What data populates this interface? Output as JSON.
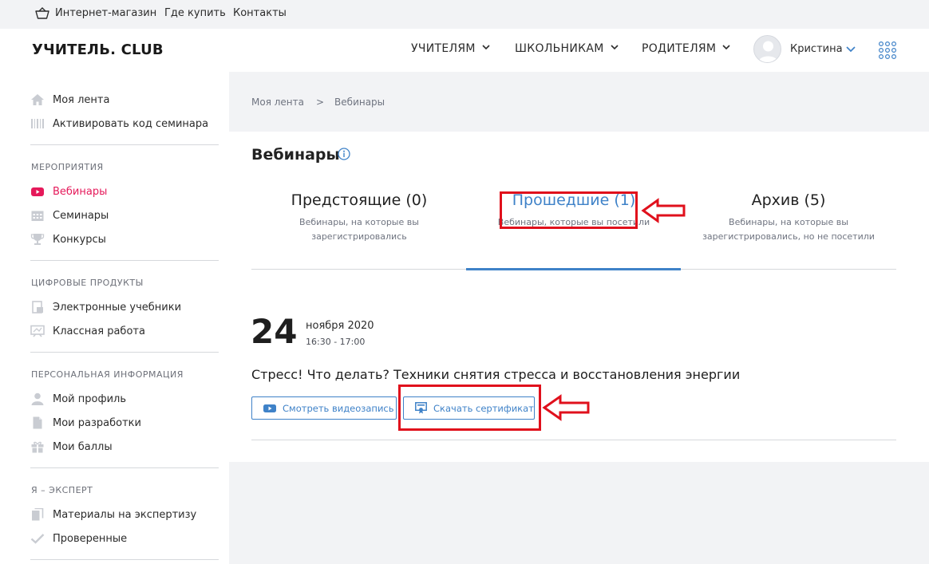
{
  "topbar": {
    "shop": "Интернет-магазин",
    "where_to_buy": "Где купить",
    "contacts": "Контакты"
  },
  "header": {
    "logo": "УЧИТЕЛЬ. CLUB",
    "menu": [
      "УЧИТЕЛЯМ",
      "ШКОЛЬНИКАМ",
      "РОДИТЕЛЯМ"
    ],
    "user_name": "Кристина",
    "icons": [
      "basket-icon",
      "chevron-down-icon",
      "avatar",
      "apps-grid-icon"
    ]
  },
  "sidebar": {
    "items_top": [
      "Моя лента",
      "Активировать код семинара"
    ],
    "sections": [
      {
        "title": "МЕРОПРИЯТИЯ",
        "items": [
          "Вебинары",
          "Семинары",
          "Конкурсы"
        ]
      },
      {
        "title": "ЦИФРОВЫЕ ПРОДУКТЫ",
        "items": [
          "Электронные учебники",
          "Классная работа"
        ]
      },
      {
        "title": "ПЕРСОНАЛЬНАЯ ИНФОРМАЦИЯ",
        "items": [
          "Мой профиль",
          "Мои разработки",
          "Мои баллы"
        ]
      },
      {
        "title": "Я – ЭКСПЕРТ",
        "items": [
          "Материалы на экспертизу",
          "Проверенные"
        ]
      }
    ],
    "active_item": "Вебинары",
    "active_color": "#e5195a"
  },
  "breadcrumb": {
    "home": "Моя лента",
    "separator": ">",
    "current": "Вебинары"
  },
  "page": {
    "title": "Вебинары"
  },
  "tabs": [
    {
      "label": "Предстоящие (0)",
      "desc": "Вебинары, на которые вы зарегистрировались"
    },
    {
      "label": "Прошедшие (1)",
      "desc": "Вебинары, которые вы посетили",
      "active": true
    },
    {
      "label": "Архив (5)",
      "desc": "Вебинары, на которые вы зарегистрировались, но не посетили"
    }
  ],
  "event": {
    "day": "24",
    "month_year": "ноября 2020",
    "time": "16:30 - 17:00",
    "title": "Стресс! Что делать? Техники снятия стресса и восстановления энергии",
    "watch_button": "Смотреть видеозапись",
    "certificate_button": "Скачать сертификат"
  },
  "colors": {
    "accent": "#3f82c8",
    "annotation": "#e0101c",
    "background": "#f2f3f5"
  }
}
